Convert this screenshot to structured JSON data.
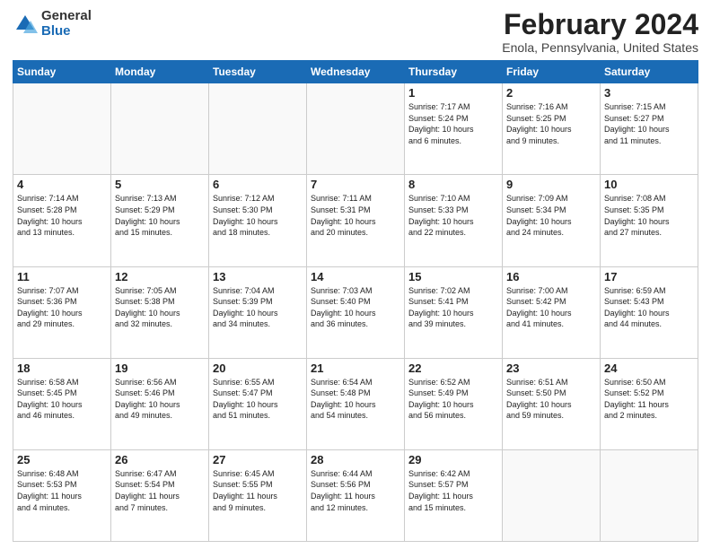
{
  "header": {
    "logo": {
      "general": "General",
      "blue": "Blue"
    },
    "title": "February 2024",
    "subtitle": "Enola, Pennsylvania, United States"
  },
  "weekdays": [
    "Sunday",
    "Monday",
    "Tuesday",
    "Wednesday",
    "Thursday",
    "Friday",
    "Saturday"
  ],
  "weeks": [
    [
      {
        "day": null,
        "info": null
      },
      {
        "day": null,
        "info": null
      },
      {
        "day": null,
        "info": null
      },
      {
        "day": null,
        "info": null
      },
      {
        "day": "1",
        "info": "Sunrise: 7:17 AM\nSunset: 5:24 PM\nDaylight: 10 hours\nand 6 minutes."
      },
      {
        "day": "2",
        "info": "Sunrise: 7:16 AM\nSunset: 5:25 PM\nDaylight: 10 hours\nand 9 minutes."
      },
      {
        "day": "3",
        "info": "Sunrise: 7:15 AM\nSunset: 5:27 PM\nDaylight: 10 hours\nand 11 minutes."
      }
    ],
    [
      {
        "day": "4",
        "info": "Sunrise: 7:14 AM\nSunset: 5:28 PM\nDaylight: 10 hours\nand 13 minutes."
      },
      {
        "day": "5",
        "info": "Sunrise: 7:13 AM\nSunset: 5:29 PM\nDaylight: 10 hours\nand 15 minutes."
      },
      {
        "day": "6",
        "info": "Sunrise: 7:12 AM\nSunset: 5:30 PM\nDaylight: 10 hours\nand 18 minutes."
      },
      {
        "day": "7",
        "info": "Sunrise: 7:11 AM\nSunset: 5:31 PM\nDaylight: 10 hours\nand 20 minutes."
      },
      {
        "day": "8",
        "info": "Sunrise: 7:10 AM\nSunset: 5:33 PM\nDaylight: 10 hours\nand 22 minutes."
      },
      {
        "day": "9",
        "info": "Sunrise: 7:09 AM\nSunset: 5:34 PM\nDaylight: 10 hours\nand 24 minutes."
      },
      {
        "day": "10",
        "info": "Sunrise: 7:08 AM\nSunset: 5:35 PM\nDaylight: 10 hours\nand 27 minutes."
      }
    ],
    [
      {
        "day": "11",
        "info": "Sunrise: 7:07 AM\nSunset: 5:36 PM\nDaylight: 10 hours\nand 29 minutes."
      },
      {
        "day": "12",
        "info": "Sunrise: 7:05 AM\nSunset: 5:38 PM\nDaylight: 10 hours\nand 32 minutes."
      },
      {
        "day": "13",
        "info": "Sunrise: 7:04 AM\nSunset: 5:39 PM\nDaylight: 10 hours\nand 34 minutes."
      },
      {
        "day": "14",
        "info": "Sunrise: 7:03 AM\nSunset: 5:40 PM\nDaylight: 10 hours\nand 36 minutes."
      },
      {
        "day": "15",
        "info": "Sunrise: 7:02 AM\nSunset: 5:41 PM\nDaylight: 10 hours\nand 39 minutes."
      },
      {
        "day": "16",
        "info": "Sunrise: 7:00 AM\nSunset: 5:42 PM\nDaylight: 10 hours\nand 41 minutes."
      },
      {
        "day": "17",
        "info": "Sunrise: 6:59 AM\nSunset: 5:43 PM\nDaylight: 10 hours\nand 44 minutes."
      }
    ],
    [
      {
        "day": "18",
        "info": "Sunrise: 6:58 AM\nSunset: 5:45 PM\nDaylight: 10 hours\nand 46 minutes."
      },
      {
        "day": "19",
        "info": "Sunrise: 6:56 AM\nSunset: 5:46 PM\nDaylight: 10 hours\nand 49 minutes."
      },
      {
        "day": "20",
        "info": "Sunrise: 6:55 AM\nSunset: 5:47 PM\nDaylight: 10 hours\nand 51 minutes."
      },
      {
        "day": "21",
        "info": "Sunrise: 6:54 AM\nSunset: 5:48 PM\nDaylight: 10 hours\nand 54 minutes."
      },
      {
        "day": "22",
        "info": "Sunrise: 6:52 AM\nSunset: 5:49 PM\nDaylight: 10 hours\nand 56 minutes."
      },
      {
        "day": "23",
        "info": "Sunrise: 6:51 AM\nSunset: 5:50 PM\nDaylight: 10 hours\nand 59 minutes."
      },
      {
        "day": "24",
        "info": "Sunrise: 6:50 AM\nSunset: 5:52 PM\nDaylight: 11 hours\nand 2 minutes."
      }
    ],
    [
      {
        "day": "25",
        "info": "Sunrise: 6:48 AM\nSunset: 5:53 PM\nDaylight: 11 hours\nand 4 minutes."
      },
      {
        "day": "26",
        "info": "Sunrise: 6:47 AM\nSunset: 5:54 PM\nDaylight: 11 hours\nand 7 minutes."
      },
      {
        "day": "27",
        "info": "Sunrise: 6:45 AM\nSunset: 5:55 PM\nDaylight: 11 hours\nand 9 minutes."
      },
      {
        "day": "28",
        "info": "Sunrise: 6:44 AM\nSunset: 5:56 PM\nDaylight: 11 hours\nand 12 minutes."
      },
      {
        "day": "29",
        "info": "Sunrise: 6:42 AM\nSunset: 5:57 PM\nDaylight: 11 hours\nand 15 minutes."
      },
      {
        "day": null,
        "info": null
      },
      {
        "day": null,
        "info": null
      }
    ]
  ]
}
